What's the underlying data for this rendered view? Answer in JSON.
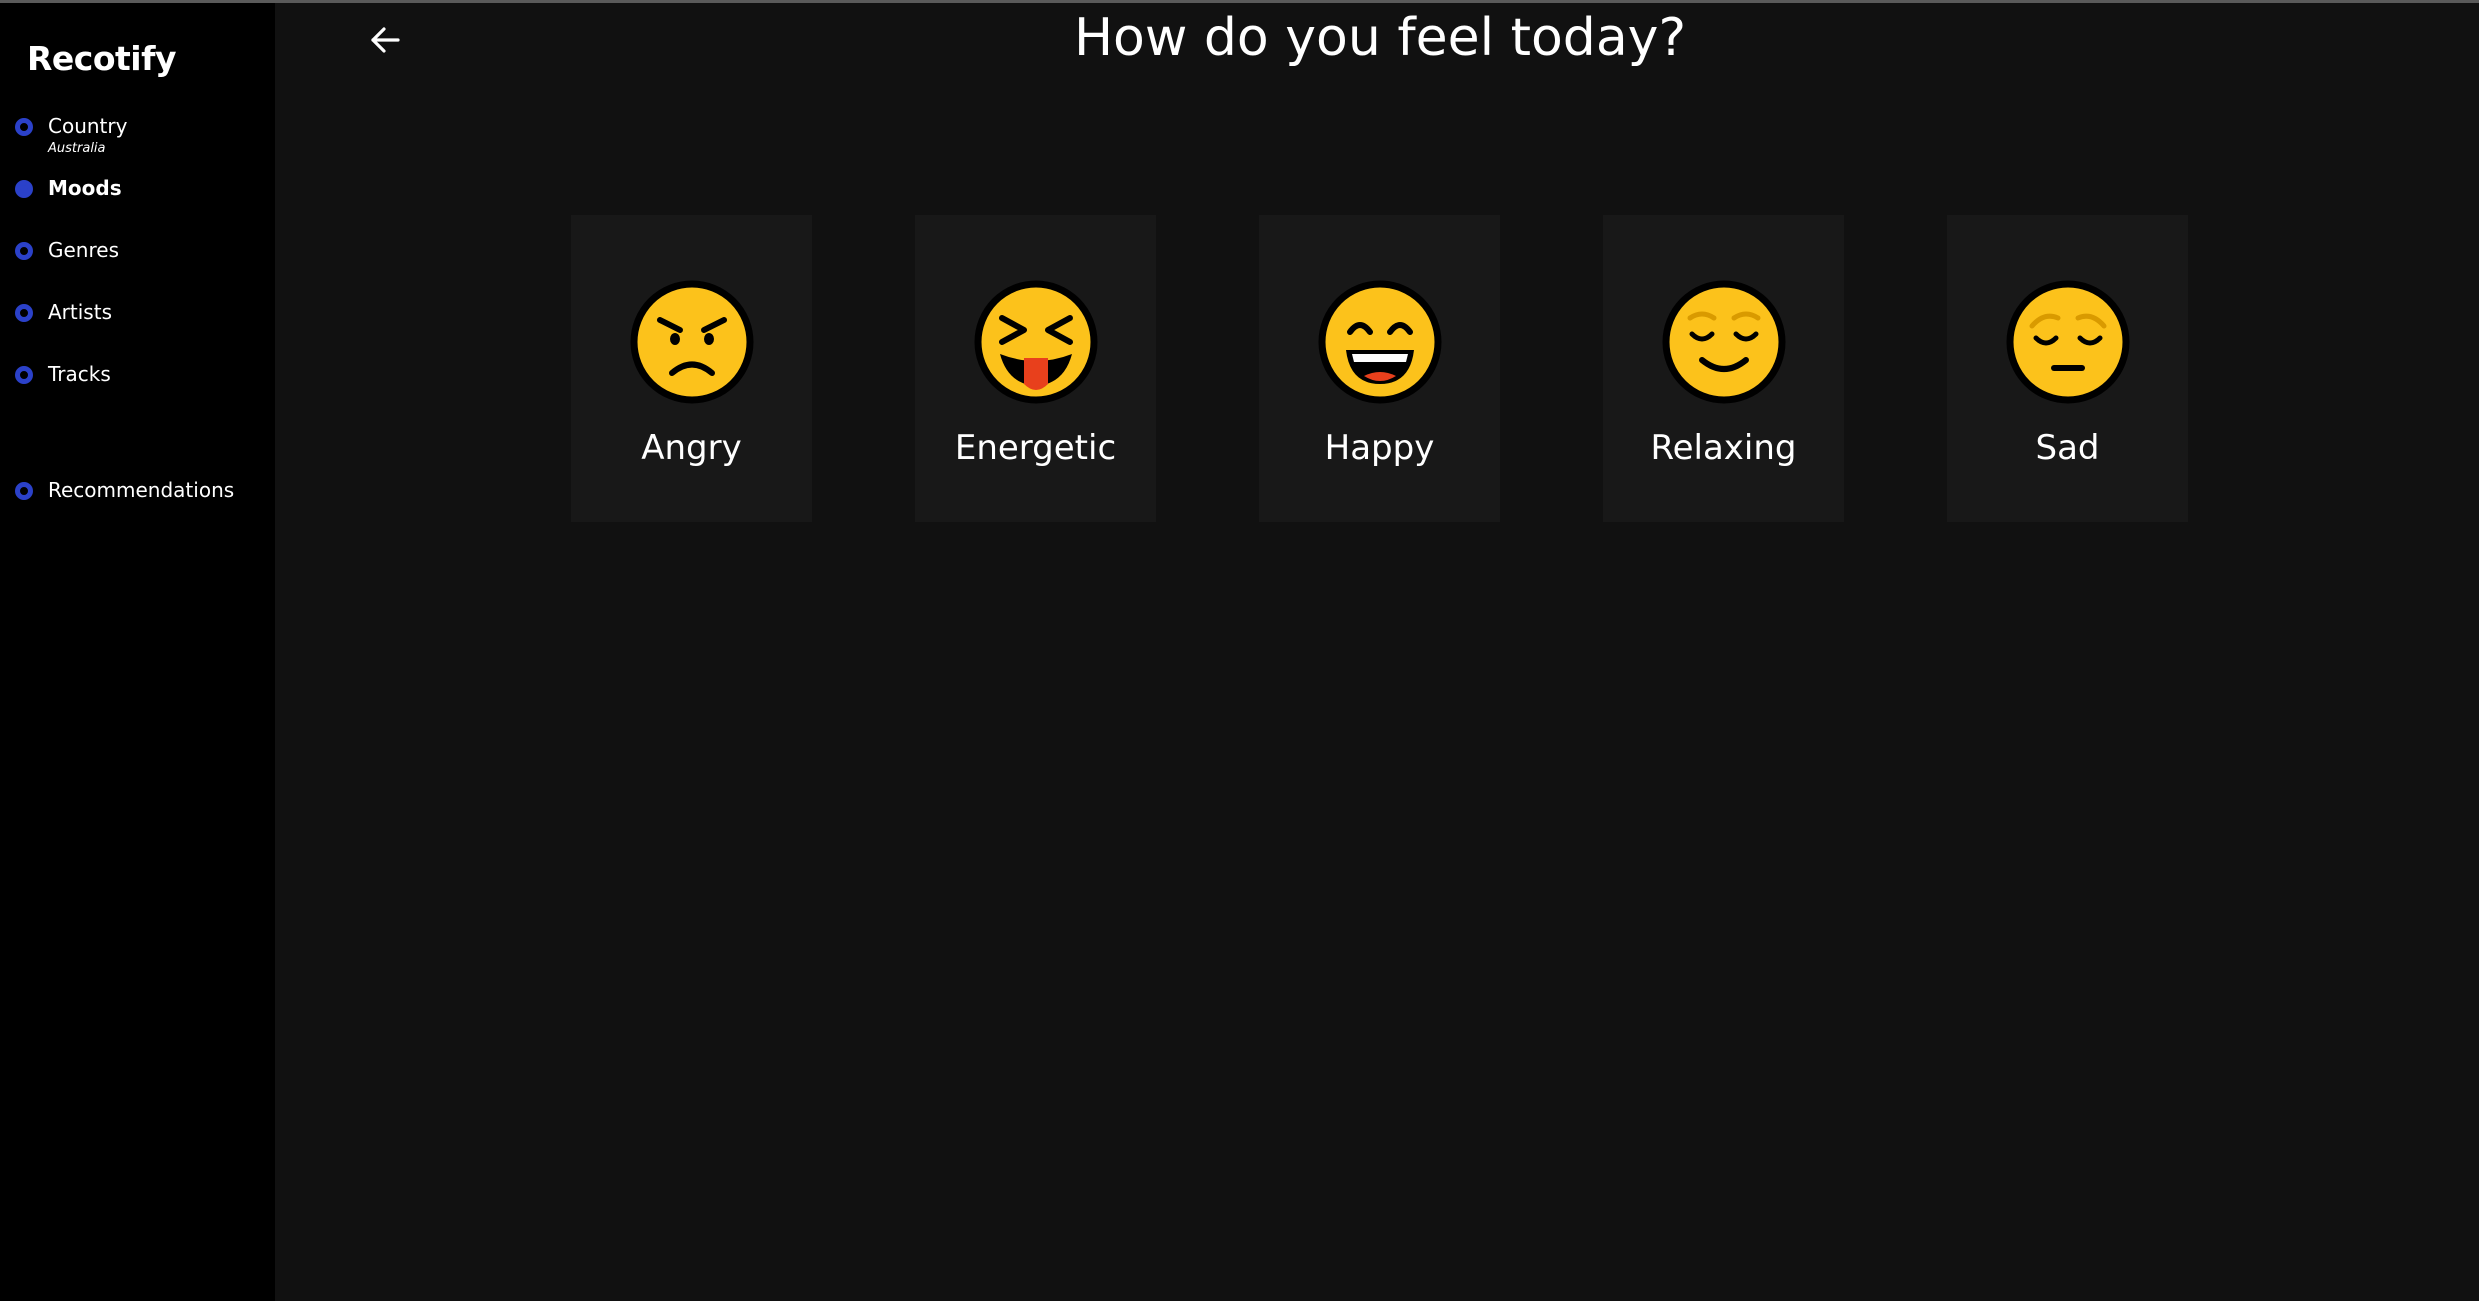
{
  "sidebar": {
    "brand": "Recotify",
    "items": [
      {
        "label": "Country",
        "sub": "Australia"
      },
      {
        "label": "Moods"
      },
      {
        "label": "Genres"
      },
      {
        "label": "Artists"
      },
      {
        "label": "Tracks"
      },
      {
        "label": "Recommendations"
      }
    ]
  },
  "main": {
    "title": "How do you feel today?",
    "back_icon": "arrow-left-icon",
    "moods": [
      {
        "label": "Angry",
        "icon": "angry-face-icon"
      },
      {
        "label": "Energetic",
        "icon": "squinting-tongue-face-icon"
      },
      {
        "label": "Happy",
        "icon": "grinning-face-icon"
      },
      {
        "label": "Relaxing",
        "icon": "relieved-face-icon"
      },
      {
        "label": "Sad",
        "icon": "pensive-face-icon"
      }
    ]
  },
  "colors": {
    "accent": "#2b41c9",
    "background": "#111111",
    "sidebar": "#000000",
    "card": "#181818",
    "emoji": "#fcc21b"
  }
}
